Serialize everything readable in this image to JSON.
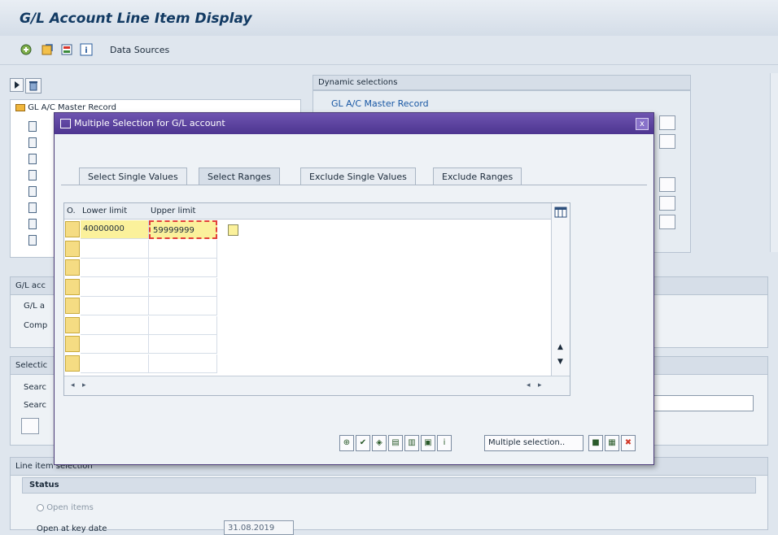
{
  "window": {
    "title": "G/L Account Line Item Display"
  },
  "toolbar": {
    "icons": [
      "execute-icon",
      "save-variant-icon",
      "select-all-icon",
      "info-icon"
    ],
    "data_sources_label": "Data Sources"
  },
  "dynamic_selections": {
    "header": "Dynamic selections",
    "link": "GL A/C Master Record"
  },
  "tree": {
    "root_label": "GL A/C Master Record"
  },
  "sections": {
    "gl_account": {
      "header": "G/L acc",
      "row1": "G/L a",
      "row2": "Comp"
    },
    "selection": {
      "header": "Selectic",
      "row1": "Searc",
      "row2": "Searc"
    },
    "line_item": {
      "header": "Line item selection",
      "status_header": "Status",
      "open_items_label": "Open items",
      "open_key_date_label": "Open at key date",
      "open_key_date_value": "31.08.2019"
    }
  },
  "dialog": {
    "title": "Multiple Selection for G/L account",
    "close_label": "x",
    "tabs": [
      {
        "label": "Select Single Values"
      },
      {
        "label": "Select Ranges"
      },
      {
        "label": "Exclude Single Values"
      },
      {
        "label": "Exclude Ranges"
      }
    ],
    "active_tab": "Select Ranges",
    "grid": {
      "columns": [
        "O.",
        "Lower limit",
        "Upper limit"
      ],
      "rows": [
        {
          "lower": "40000000",
          "upper": "59999999"
        },
        {
          "lower": "",
          "upper": ""
        },
        {
          "lower": "",
          "upper": ""
        },
        {
          "lower": "",
          "upper": ""
        },
        {
          "lower": "",
          "upper": ""
        },
        {
          "lower": "",
          "upper": ""
        },
        {
          "lower": "",
          "upper": ""
        },
        {
          "lower": "",
          "upper": ""
        }
      ]
    },
    "footer": {
      "multiple_selection_label": "Multiple selection.."
    }
  }
}
